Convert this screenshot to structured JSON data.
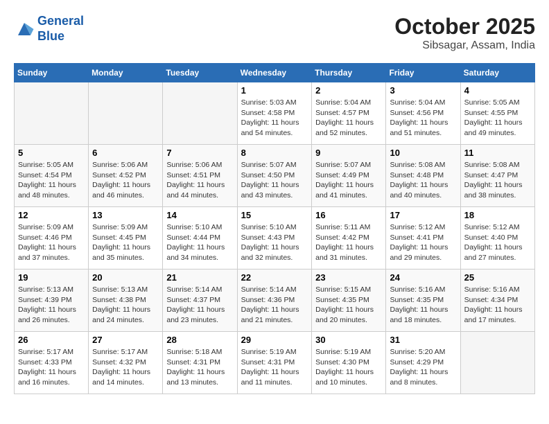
{
  "header": {
    "logo_line1": "General",
    "logo_line2": "Blue",
    "title": "October 2025",
    "subtitle": "Sibsagar, Assam, India"
  },
  "weekdays": [
    "Sunday",
    "Monday",
    "Tuesday",
    "Wednesday",
    "Thursday",
    "Friday",
    "Saturday"
  ],
  "rows": [
    [
      {
        "day": "",
        "info": ""
      },
      {
        "day": "",
        "info": ""
      },
      {
        "day": "",
        "info": ""
      },
      {
        "day": "1",
        "info": "Sunrise: 5:03 AM\nSunset: 4:58 PM\nDaylight: 11 hours\nand 54 minutes."
      },
      {
        "day": "2",
        "info": "Sunrise: 5:04 AM\nSunset: 4:57 PM\nDaylight: 11 hours\nand 52 minutes."
      },
      {
        "day": "3",
        "info": "Sunrise: 5:04 AM\nSunset: 4:56 PM\nDaylight: 11 hours\nand 51 minutes."
      },
      {
        "day": "4",
        "info": "Sunrise: 5:05 AM\nSunset: 4:55 PM\nDaylight: 11 hours\nand 49 minutes."
      }
    ],
    [
      {
        "day": "5",
        "info": "Sunrise: 5:05 AM\nSunset: 4:54 PM\nDaylight: 11 hours\nand 48 minutes."
      },
      {
        "day": "6",
        "info": "Sunrise: 5:06 AM\nSunset: 4:52 PM\nDaylight: 11 hours\nand 46 minutes."
      },
      {
        "day": "7",
        "info": "Sunrise: 5:06 AM\nSunset: 4:51 PM\nDaylight: 11 hours\nand 44 minutes."
      },
      {
        "day": "8",
        "info": "Sunrise: 5:07 AM\nSunset: 4:50 PM\nDaylight: 11 hours\nand 43 minutes."
      },
      {
        "day": "9",
        "info": "Sunrise: 5:07 AM\nSunset: 4:49 PM\nDaylight: 11 hours\nand 41 minutes."
      },
      {
        "day": "10",
        "info": "Sunrise: 5:08 AM\nSunset: 4:48 PM\nDaylight: 11 hours\nand 40 minutes."
      },
      {
        "day": "11",
        "info": "Sunrise: 5:08 AM\nSunset: 4:47 PM\nDaylight: 11 hours\nand 38 minutes."
      }
    ],
    [
      {
        "day": "12",
        "info": "Sunrise: 5:09 AM\nSunset: 4:46 PM\nDaylight: 11 hours\nand 37 minutes."
      },
      {
        "day": "13",
        "info": "Sunrise: 5:09 AM\nSunset: 4:45 PM\nDaylight: 11 hours\nand 35 minutes."
      },
      {
        "day": "14",
        "info": "Sunrise: 5:10 AM\nSunset: 4:44 PM\nDaylight: 11 hours\nand 34 minutes."
      },
      {
        "day": "15",
        "info": "Sunrise: 5:10 AM\nSunset: 4:43 PM\nDaylight: 11 hours\nand 32 minutes."
      },
      {
        "day": "16",
        "info": "Sunrise: 5:11 AM\nSunset: 4:42 PM\nDaylight: 11 hours\nand 31 minutes."
      },
      {
        "day": "17",
        "info": "Sunrise: 5:12 AM\nSunset: 4:41 PM\nDaylight: 11 hours\nand 29 minutes."
      },
      {
        "day": "18",
        "info": "Sunrise: 5:12 AM\nSunset: 4:40 PM\nDaylight: 11 hours\nand 27 minutes."
      }
    ],
    [
      {
        "day": "19",
        "info": "Sunrise: 5:13 AM\nSunset: 4:39 PM\nDaylight: 11 hours\nand 26 minutes."
      },
      {
        "day": "20",
        "info": "Sunrise: 5:13 AM\nSunset: 4:38 PM\nDaylight: 11 hours\nand 24 minutes."
      },
      {
        "day": "21",
        "info": "Sunrise: 5:14 AM\nSunset: 4:37 PM\nDaylight: 11 hours\nand 23 minutes."
      },
      {
        "day": "22",
        "info": "Sunrise: 5:14 AM\nSunset: 4:36 PM\nDaylight: 11 hours\nand 21 minutes."
      },
      {
        "day": "23",
        "info": "Sunrise: 5:15 AM\nSunset: 4:35 PM\nDaylight: 11 hours\nand 20 minutes."
      },
      {
        "day": "24",
        "info": "Sunrise: 5:16 AM\nSunset: 4:35 PM\nDaylight: 11 hours\nand 18 minutes."
      },
      {
        "day": "25",
        "info": "Sunrise: 5:16 AM\nSunset: 4:34 PM\nDaylight: 11 hours\nand 17 minutes."
      }
    ],
    [
      {
        "day": "26",
        "info": "Sunrise: 5:17 AM\nSunset: 4:33 PM\nDaylight: 11 hours\nand 16 minutes."
      },
      {
        "day": "27",
        "info": "Sunrise: 5:17 AM\nSunset: 4:32 PM\nDaylight: 11 hours\nand 14 minutes."
      },
      {
        "day": "28",
        "info": "Sunrise: 5:18 AM\nSunset: 4:31 PM\nDaylight: 11 hours\nand 13 minutes."
      },
      {
        "day": "29",
        "info": "Sunrise: 5:19 AM\nSunset: 4:31 PM\nDaylight: 11 hours\nand 11 minutes."
      },
      {
        "day": "30",
        "info": "Sunrise: 5:19 AM\nSunset: 4:30 PM\nDaylight: 11 hours\nand 10 minutes."
      },
      {
        "day": "31",
        "info": "Sunrise: 5:20 AM\nSunset: 4:29 PM\nDaylight: 11 hours\nand 8 minutes."
      },
      {
        "day": "",
        "info": ""
      }
    ]
  ]
}
